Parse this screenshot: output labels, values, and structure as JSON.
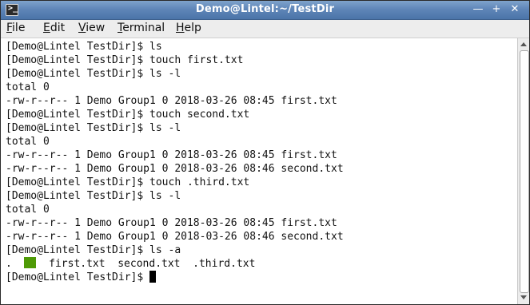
{
  "window": {
    "title": "Demo@Lintel:~/TestDir",
    "icon": "terminal-icon",
    "buttons": {
      "minimize": "—",
      "maximize": "+",
      "close": "✕"
    }
  },
  "menubar": {
    "items": [
      {
        "mnemonic": "F",
        "rest": "ile"
      },
      {
        "mnemonic": "E",
        "rest": "dit"
      },
      {
        "mnemonic": "V",
        "rest": "iew"
      },
      {
        "mnemonic": "T",
        "rest": "erminal"
      },
      {
        "mnemonic": "H",
        "rest": "elp"
      }
    ]
  },
  "terminal": {
    "lines": [
      "[Demo@Lintel TestDir]$ ls",
      "[Demo@Lintel TestDir]$ touch first.txt",
      "[Demo@Lintel TestDir]$ ls -l",
      "total 0",
      "-rw-r--r-- 1 Demo Group1 0 2018-03-26 08:45 first.txt",
      "[Demo@Lintel TestDir]$ touch second.txt",
      "[Demo@Lintel TestDir]$ ls -l",
      "total 0",
      "-rw-r--r-- 1 Demo Group1 0 2018-03-26 08:45 first.txt",
      "-rw-r--r-- 1 Demo Group1 0 2018-03-26 08:46 second.txt",
      "[Demo@Lintel TestDir]$ touch .third.txt",
      "[Demo@Lintel TestDir]$ ls -l",
      "total 0",
      "-rw-r--r-- 1 Demo Group1 0 2018-03-26 08:45 first.txt",
      "-rw-r--r-- 1 Demo Group1 0 2018-03-26 08:46 second.txt",
      "[Demo@Lintel TestDir]$ ls -a"
    ],
    "ls_a_output": {
      "dot": ".",
      "dotdot_highlight_color": "#4e9a06",
      "files": "  first.txt  second.txt  .third.txt"
    },
    "prompt": "[Demo@Lintel TestDir]$ "
  }
}
